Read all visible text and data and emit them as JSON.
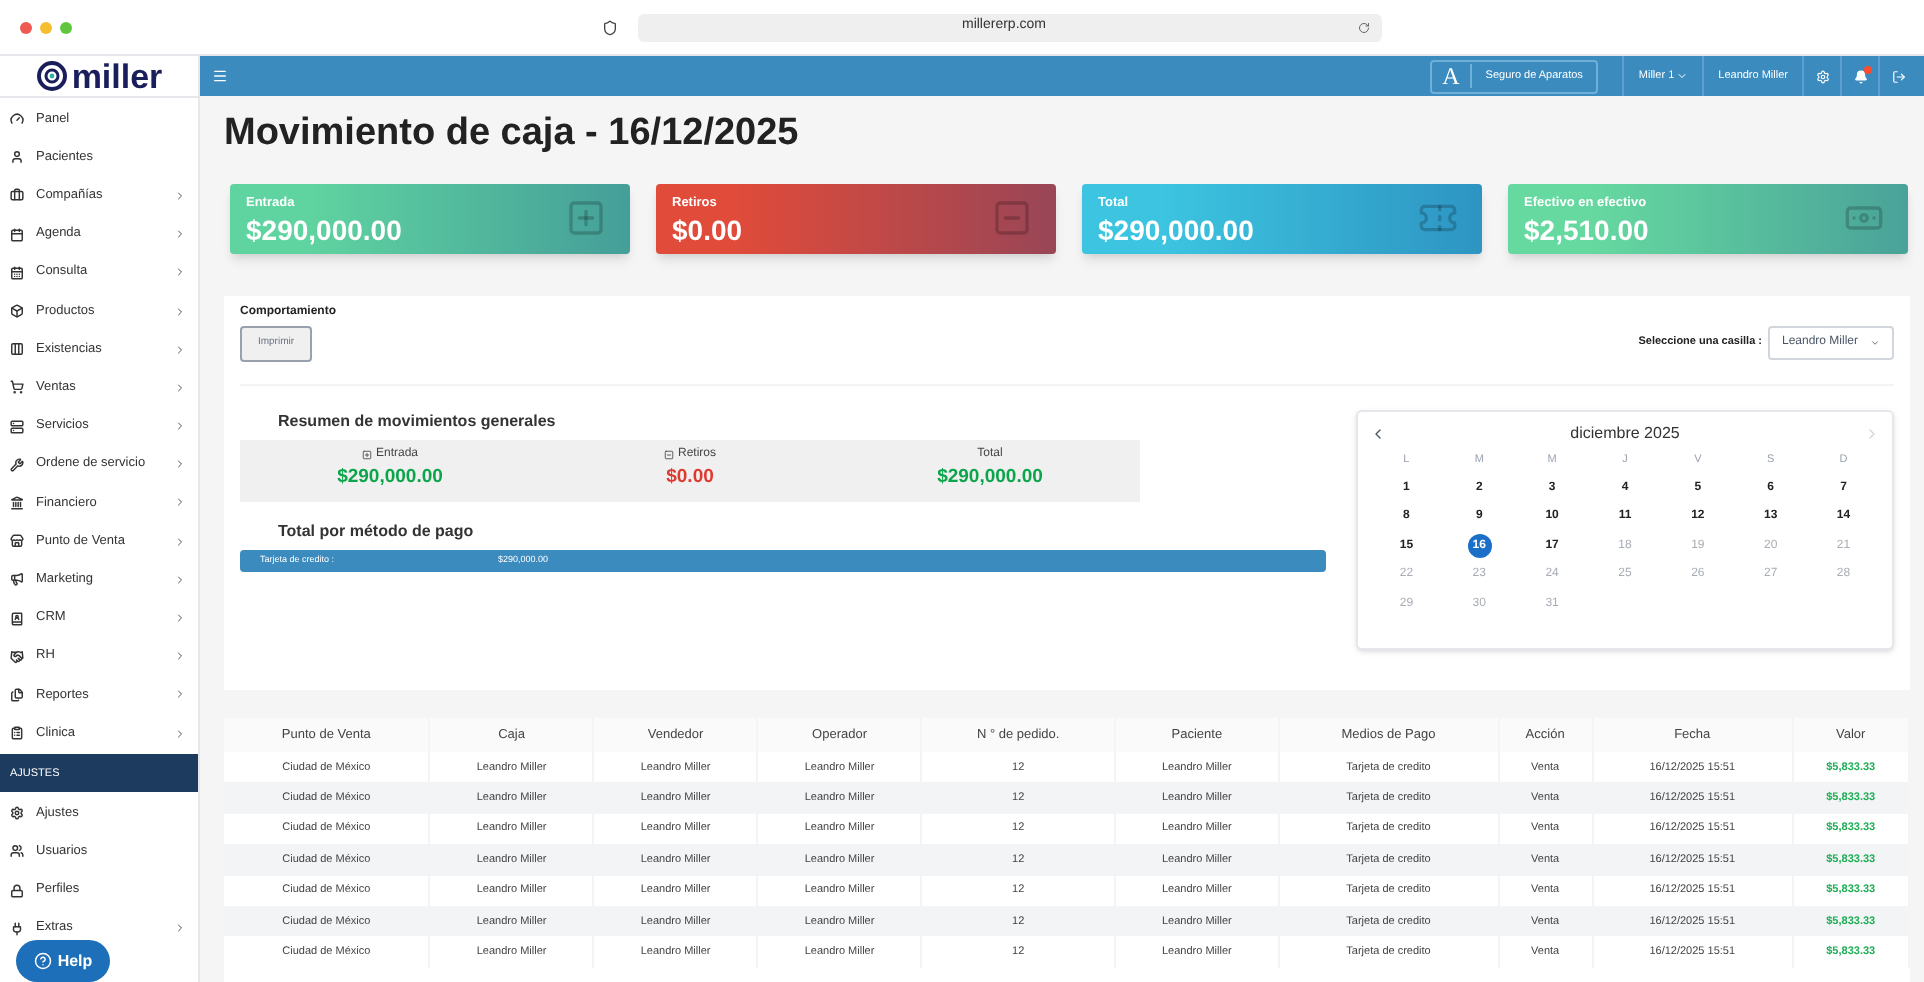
{
  "browser": {
    "url": "millererp.com"
  },
  "sidebar": {
    "logo": "miller",
    "items": [
      {
        "kind": "link",
        "label": "Panel",
        "has_submenu": false
      },
      {
        "kind": "link",
        "label": "Pacientes",
        "has_submenu": false
      },
      {
        "kind": "link",
        "label": "Compañías",
        "has_submenu": true
      },
      {
        "kind": "link",
        "label": "Agenda",
        "has_submenu": true
      },
      {
        "kind": "link",
        "label": "Consulta",
        "has_submenu": true
      },
      {
        "kind": "link",
        "label": "Productos",
        "has_submenu": true
      },
      {
        "kind": "link",
        "label": "Existencias",
        "has_submenu": true
      },
      {
        "kind": "link",
        "label": "Ventas",
        "has_submenu": true
      },
      {
        "kind": "link",
        "label": "Servicios",
        "has_submenu": true
      },
      {
        "kind": "link",
        "label": "Ordene de servicio",
        "has_submenu": true
      },
      {
        "kind": "link",
        "label": "Financiero",
        "has_submenu": true
      },
      {
        "kind": "link",
        "label": "Punto de Venta",
        "has_submenu": true
      },
      {
        "kind": "link",
        "label": "Marketing",
        "has_submenu": true
      },
      {
        "kind": "link",
        "label": "CRM",
        "has_submenu": true
      },
      {
        "kind": "link",
        "label": "RH",
        "has_submenu": true
      },
      {
        "kind": "link",
        "label": "Reportes",
        "has_submenu": true
      },
      {
        "kind": "link",
        "label": "Clinica",
        "has_submenu": true
      },
      {
        "kind": "header",
        "label": "AJUSTES"
      },
      {
        "kind": "link",
        "label": "Ajustes",
        "has_submenu": false
      },
      {
        "kind": "link",
        "label": "Usuarios",
        "has_submenu": false
      },
      {
        "kind": "link",
        "label": "Perfiles",
        "has_submenu": false
      },
      {
        "kind": "link",
        "label": "Extras",
        "has_submenu": true
      }
    ],
    "help": "Help"
  },
  "topbar": {
    "brand_letter": "A",
    "brand": "Seguro de Aparatos",
    "account": "Miller 1",
    "user": "Leandro Miller",
    "notification": true
  },
  "page_title": "Movimiento de caja - 16/12/2025",
  "cards": [
    {
      "label": "Entrada",
      "value": "$290,000.00",
      "color": "#5fd3a0"
    },
    {
      "label": "Retiros",
      "value": "$0.00",
      "color": "#e04b3a"
    },
    {
      "label": "Total",
      "value": "$290,000.00",
      "color": "#3cc4e0"
    },
    {
      "label": "Efectivo en efectivo",
      "value": "$2,510.00",
      "color": "#66d9a0"
    }
  ],
  "behavior": {
    "title": "Comportamiento",
    "print_button": "Imprimir",
    "select_label": "Seleccione una casilla :",
    "select_value": "Leandro Miller"
  },
  "summary": {
    "title": "Resumen de movimientos generales",
    "items": [
      {
        "kind": "in",
        "label": "Entrada",
        "value": "$290,000.00"
      },
      {
        "kind": "out",
        "label": "Retiros",
        "value": "$0.00"
      },
      {
        "kind": "total",
        "label": "Total",
        "value": "$290,000.00"
      }
    ]
  },
  "payment": {
    "title": "Total por método de pago",
    "rows": [
      {
        "label": "Tarjeta de credito :",
        "value": "$290,000.00"
      }
    ]
  },
  "calendar": {
    "month": "diciembre 2025",
    "prev_disabled": false,
    "next_disabled": true,
    "weekdays": [
      "L",
      "M",
      "M",
      "J",
      "V",
      "S",
      "D"
    ],
    "days": [
      {
        "label": "1",
        "disabled": false,
        "selected": false
      },
      {
        "label": "2",
        "disabled": false,
        "selected": false
      },
      {
        "label": "3",
        "disabled": false,
        "selected": false
      },
      {
        "label": "4",
        "disabled": false,
        "selected": false
      },
      {
        "label": "5",
        "disabled": false,
        "selected": false
      },
      {
        "label": "6",
        "disabled": false,
        "selected": false
      },
      {
        "label": "7",
        "disabled": false,
        "selected": false
      },
      {
        "label": "8",
        "disabled": false,
        "selected": false
      },
      {
        "label": "9",
        "disabled": false,
        "selected": false
      },
      {
        "label": "10",
        "disabled": false,
        "selected": false
      },
      {
        "label": "11",
        "disabled": false,
        "selected": false
      },
      {
        "label": "12",
        "disabled": false,
        "selected": false
      },
      {
        "label": "13",
        "disabled": false,
        "selected": false
      },
      {
        "label": "14",
        "disabled": false,
        "selected": false
      },
      {
        "label": "15",
        "disabled": false,
        "selected": false
      },
      {
        "label": "16",
        "disabled": false,
        "selected": true
      },
      {
        "label": "17",
        "disabled": false,
        "selected": false
      },
      {
        "label": "18",
        "disabled": true,
        "selected": false
      },
      {
        "label": "19",
        "disabled": true,
        "selected": false
      },
      {
        "label": "20",
        "disabled": true,
        "selected": false
      },
      {
        "label": "21",
        "disabled": true,
        "selected": false
      },
      {
        "label": "22",
        "disabled": true,
        "selected": false
      },
      {
        "label": "23",
        "disabled": true,
        "selected": false
      },
      {
        "label": "24",
        "disabled": true,
        "selected": false
      },
      {
        "label": "25",
        "disabled": true,
        "selected": false
      },
      {
        "label": "26",
        "disabled": true,
        "selected": false
      },
      {
        "label": "27",
        "disabled": true,
        "selected": false
      },
      {
        "label": "28",
        "disabled": true,
        "selected": false
      },
      {
        "label": "29",
        "disabled": true,
        "selected": false
      },
      {
        "label": "30",
        "disabled": true,
        "selected": false
      },
      {
        "label": "31",
        "disabled": true,
        "selected": false
      }
    ]
  },
  "table": {
    "columns": [
      "Punto de Venta",
      "Caja",
      "Vendedor",
      "Operador",
      "N ° de pedido.",
      "Paciente",
      "Medios de Pago",
      "Acción",
      "Fecha",
      "Valor"
    ],
    "rows": [
      [
        "Ciudad de México",
        "Leandro Miller",
        "Leandro Miller",
        "Leandro Miller",
        "12",
        "Leandro Miller",
        "Tarjeta de credito",
        "Venta",
        "16/12/2025 15:51",
        "$5,833.33"
      ],
      [
        "Ciudad de México",
        "Leandro Miller",
        "Leandro Miller",
        "Leandro Miller",
        "12",
        "Leandro Miller",
        "Tarjeta de credito",
        "Venta",
        "16/12/2025 15:51",
        "$5,833.33"
      ],
      [
        "Ciudad de México",
        "Leandro Miller",
        "Leandro Miller",
        "Leandro Miller",
        "12",
        "Leandro Miller",
        "Tarjeta de credito",
        "Venta",
        "16/12/2025 15:51",
        "$5,833.33"
      ],
      [
        "Ciudad de México",
        "Leandro Miller",
        "Leandro Miller",
        "Leandro Miller",
        "12",
        "Leandro Miller",
        "Tarjeta de credito",
        "Venta",
        "16/12/2025 15:51",
        "$5,833.33"
      ],
      [
        "Ciudad de México",
        "Leandro Miller",
        "Leandro Miller",
        "Leandro Miller",
        "12",
        "Leandro Miller",
        "Tarjeta de credito",
        "Venta",
        "16/12/2025 15:51",
        "$5,833.33"
      ],
      [
        "Ciudad de México",
        "Leandro Miller",
        "Leandro Miller",
        "Leandro Miller",
        "12",
        "Leandro Miller",
        "Tarjeta de credito",
        "Venta",
        "16/12/2025 15:51",
        "$5,833.33"
      ],
      [
        "Ciudad de México",
        "Leandro Miller",
        "Leandro Miller",
        "Leandro Miller",
        "12",
        "Leandro Miller",
        "Tarjeta de credito",
        "Venta",
        "16/12/2025 15:51",
        "$5,833.33"
      ]
    ]
  }
}
